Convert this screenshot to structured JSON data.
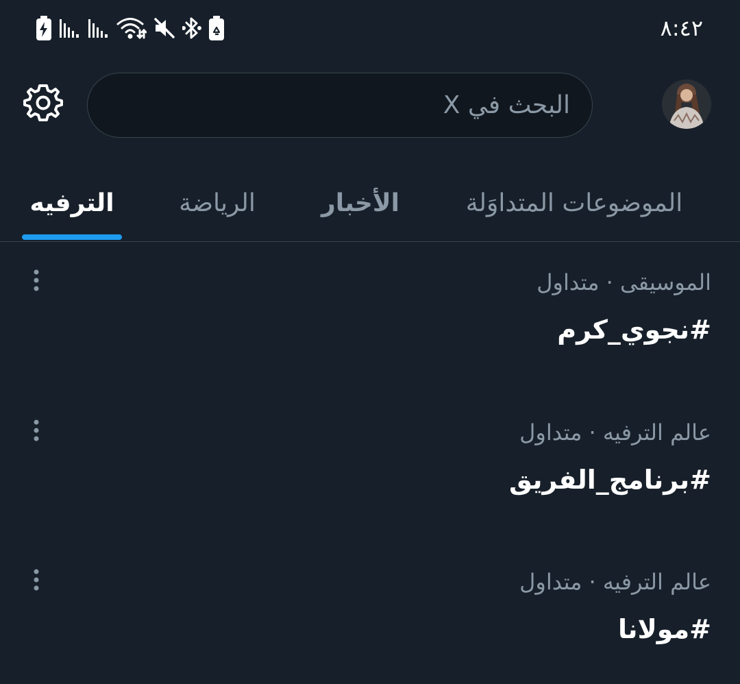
{
  "status_bar": {
    "time": "٨:٤٢",
    "icons": [
      "battery-charging-icon",
      "signal-icon",
      "signal-icon",
      "wifi-icon",
      "mute-icon",
      "bluetooth-icon",
      "battery-saver-icon"
    ]
  },
  "header": {
    "settings_icon": "gear-icon",
    "search": {
      "placeholder": "البحث في X",
      "value": ""
    },
    "avatar": "profile-avatar"
  },
  "tabs": [
    {
      "label": "الموضوعات المتداوَلة",
      "active": false
    },
    {
      "label": "الأخبار",
      "active": false
    },
    {
      "label": "الرياضة",
      "active": false
    },
    {
      "label": "الترفيه",
      "active": true
    }
  ],
  "trends": [
    {
      "meta": "الموسيقى · متداول",
      "tag": "#نجوي_كرم"
    },
    {
      "meta": "عالم الترفيه · متداول",
      "tag": "#برنامج_الفريق"
    },
    {
      "meta": "عالم الترفيه · متداول",
      "tag": "#مولانا"
    }
  ],
  "colors": {
    "background": "#17202a",
    "accent": "#1d9bf0",
    "muted_text": "#8b98a5",
    "primary_text": "#ffffff",
    "border": "#38444d"
  }
}
